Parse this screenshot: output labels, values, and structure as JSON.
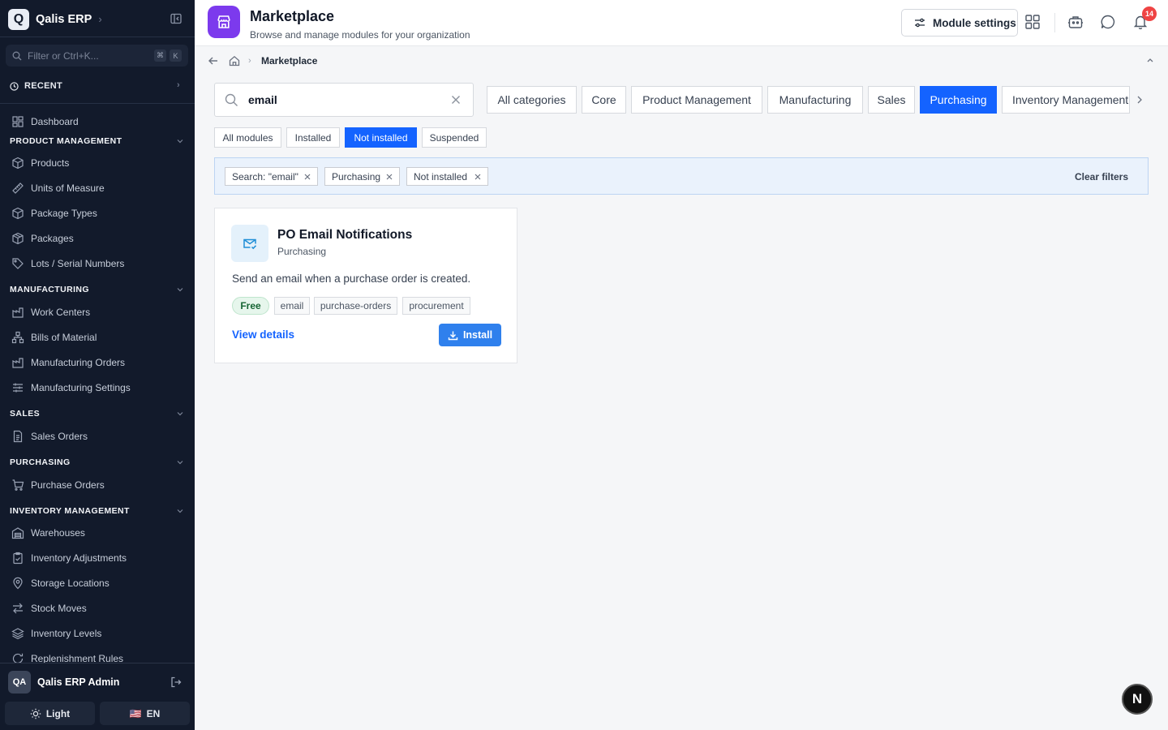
{
  "brand": {
    "logo_letter": "Q",
    "name": "Qalis ERP"
  },
  "sidebar": {
    "filter_placeholder": "Filter or Ctrl+K...",
    "kbd": [
      "⌘",
      "K"
    ],
    "recent_label": "RECENT",
    "dashboard": "Dashboard",
    "sections": {
      "product_management": {
        "title": "PRODUCT MANAGEMENT",
        "items": [
          "Products",
          "Units of Measure",
          "Package Types",
          "Packages",
          "Lots / Serial Numbers"
        ]
      },
      "manufacturing": {
        "title": "MANUFACTURING",
        "items": [
          "Work Centers",
          "Bills of Material",
          "Manufacturing Orders",
          "Manufacturing Settings"
        ]
      },
      "sales": {
        "title": "SALES",
        "items": [
          "Sales Orders"
        ]
      },
      "purchasing": {
        "title": "PURCHASING",
        "items": [
          "Purchase Orders"
        ]
      },
      "inventory_management": {
        "title": "INVENTORY MANAGEMENT",
        "items": [
          "Warehouses",
          "Inventory Adjustments",
          "Storage Locations",
          "Stock Moves",
          "Inventory Levels",
          "Replenishment Rules"
        ]
      }
    },
    "user": {
      "initials": "QA",
      "name": "Qalis ERP Admin"
    },
    "theme_label": "Light",
    "language_label": "EN",
    "language_flag": "🇺🇸"
  },
  "header": {
    "title": "Marketplace",
    "subtitle": "Browse and manage modules for your organization",
    "module_settings_label": "Module settings",
    "notification_count": "14"
  },
  "breadcrumb": {
    "current": "Marketplace"
  },
  "search": {
    "value": "email"
  },
  "categories": [
    "All categories",
    "Core",
    "Product Management",
    "Manufacturing",
    "Sales",
    "Purchasing",
    "Inventory Management"
  ],
  "active_category": "Purchasing",
  "status_tabs": [
    "All modules",
    "Installed",
    "Not installed",
    "Suspended"
  ],
  "active_status": "Not installed",
  "active_filters": [
    "Search: \"email\"",
    "Purchasing",
    "Not installed"
  ],
  "clear_filters_label": "Clear filters",
  "module_card": {
    "title": "PO Email Notifications",
    "category": "Purchasing",
    "description": "Send an email when a purchase order is created.",
    "price_tag": "Free",
    "tags": [
      "email",
      "purchase-orders",
      "procurement"
    ],
    "view_details_label": "View details",
    "install_label": "Install"
  },
  "floating_button_letter": "N",
  "colors": {
    "sidebar_bg": "#121a2b",
    "accent": "#1463ff",
    "app_icon": "#7c3aed",
    "install": "#2f80ed",
    "badge": "#ef4444"
  }
}
